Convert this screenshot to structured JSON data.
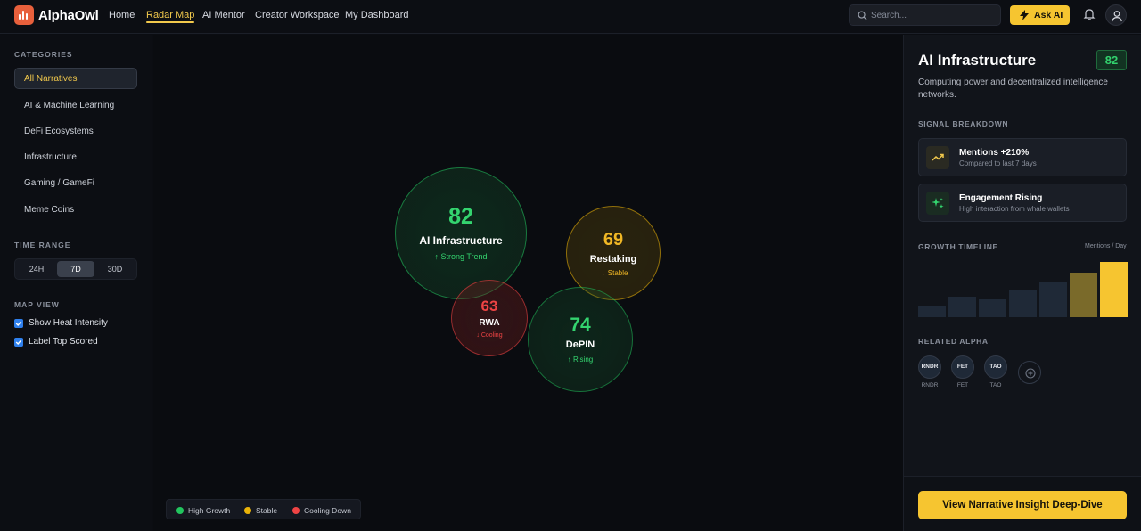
{
  "app": {
    "brand": "AlphaOwl"
  },
  "nav": [
    {
      "label": "Home",
      "active": false
    },
    {
      "label": "Radar Map",
      "active": true
    },
    {
      "label": "AI Mentor",
      "active": false
    },
    {
      "label": "Creator Workspace",
      "active": false
    },
    {
      "label": "My Dashboard",
      "active": false
    }
  ],
  "search": {
    "placeholder": "Search..."
  },
  "ask_ai": {
    "label": "Ask AI"
  },
  "sidebar": {
    "categories_title": "CATEGORIES",
    "categories": [
      {
        "label": "All Narratives",
        "active": true
      },
      {
        "label": "AI & Machine Learning",
        "active": false
      },
      {
        "label": "DeFi Ecosystems",
        "active": false
      },
      {
        "label": "Infrastructure",
        "active": false
      },
      {
        "label": "Gaming / GameFi",
        "active": false
      },
      {
        "label": "Meme Coins",
        "active": false
      }
    ],
    "time_range_title": "TIME RANGE",
    "time_range": [
      {
        "label": "24H",
        "active": false
      },
      {
        "label": "7D",
        "active": true
      },
      {
        "label": "30D",
        "active": false
      }
    ],
    "map_view_title": "MAP VIEW",
    "map_view": [
      {
        "label": "Show Heat Intensity",
        "checked": true
      },
      {
        "label": "Label Top Scored",
        "checked": true
      }
    ]
  },
  "map": {
    "bubbles": [
      {
        "score": "82",
        "name": "AI Infrastructure",
        "trend": "↑ Strong Trend",
        "status": "growth"
      },
      {
        "score": "69",
        "name": "Restaking",
        "trend": "→ Stable",
        "status": "stable"
      },
      {
        "score": "63",
        "name": "RWA",
        "trend": "↓ Cooling",
        "status": "cooling"
      },
      {
        "score": "74",
        "name": "DePIN",
        "trend": "↑ Rising",
        "status": "growth"
      }
    ],
    "legend": [
      {
        "label": "High Growth",
        "color": "#22c55e"
      },
      {
        "label": "Stable",
        "color": "#eab308"
      },
      {
        "label": "Cooling Down",
        "color": "#ef4444"
      }
    ]
  },
  "panel": {
    "title": "AI Infrastructure",
    "score": "82",
    "description": "Computing power and decentralized intelligence networks.",
    "signal_title": "SIGNAL BREAKDOWN",
    "signals": [
      {
        "title": "Mentions +210%",
        "subtitle": "Compared to last 7 days",
        "icon": "trending-up-icon"
      },
      {
        "title": "Engagement Rising",
        "subtitle": "High interaction from whale wallets",
        "icon": "sparkle-icon"
      }
    ],
    "timeline_title": "GROWTH TIMELINE",
    "timeline_unit": "Mentions / Day",
    "timeline_values": [
      12,
      22,
      19,
      29,
      38,
      48,
      60
    ],
    "related_title": "RELATED ALPHA",
    "related": [
      {
        "symbol": "RNDR",
        "label": "RNDR"
      },
      {
        "symbol": "FET",
        "label": "FET"
      },
      {
        "symbol": "TAO",
        "label": "TAO"
      }
    ],
    "cta": "View Narrative Insight Deep-Dive"
  },
  "colors": {
    "accent": "#f6c530",
    "growth": "#22c55e",
    "stable": "#eab308",
    "cooling": "#ef4444"
  }
}
